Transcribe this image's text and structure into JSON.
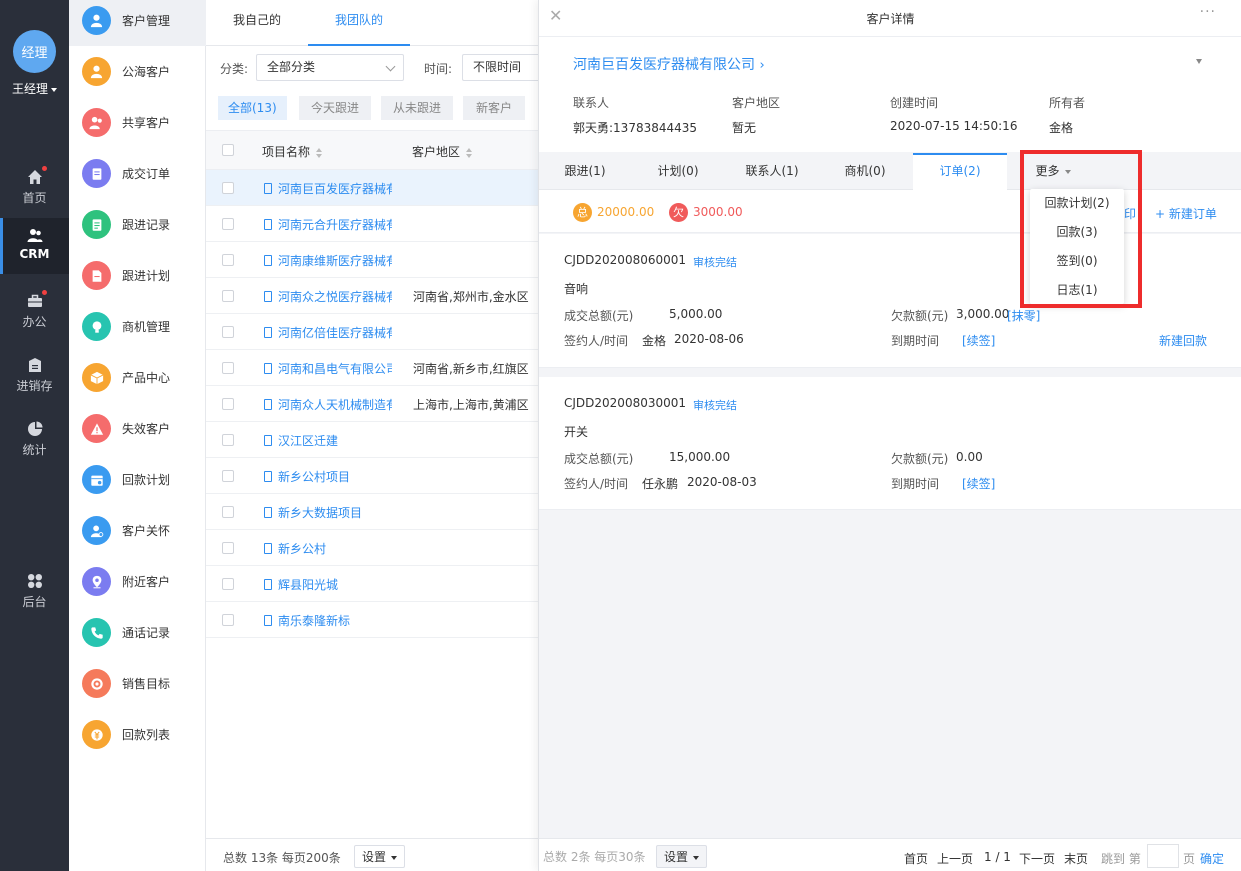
{
  "nav": {
    "avatar_text": "经理",
    "user_name": "王经理",
    "items": [
      {
        "label": "首页",
        "dot": true
      },
      {
        "label": "CRM",
        "dot": false
      },
      {
        "label": "办公",
        "dot": true
      },
      {
        "label": "进销存",
        "dot": false
      },
      {
        "label": "统计",
        "dot": false
      },
      {
        "label": "后台",
        "dot": false
      }
    ]
  },
  "menu": {
    "items": [
      {
        "label": "客户管理",
        "color": "#3a9bf0"
      },
      {
        "label": "公海客户",
        "color": "#f7a531"
      },
      {
        "label": "共享客户",
        "color": "#f56c6c"
      },
      {
        "label": "成交订单",
        "color": "#7b7cf0"
      },
      {
        "label": "跟进记录",
        "color": "#2ec27e"
      },
      {
        "label": "跟进计划",
        "color": "#f56c6c"
      },
      {
        "label": "商机管理",
        "color": "#27c4b0"
      },
      {
        "label": "产品中心",
        "color": "#f7a531"
      },
      {
        "label": "失效客户",
        "color": "#f56c6c"
      },
      {
        "label": "回款计划",
        "color": "#3a9bf0"
      },
      {
        "label": "客户关怀",
        "color": "#3a9bf0"
      },
      {
        "label": "附近客户",
        "color": "#7b7cf0"
      },
      {
        "label": "通话记录",
        "color": "#27c4b0"
      },
      {
        "label": "销售目标",
        "color": "#f57a5b"
      },
      {
        "label": "回款列表",
        "color": "#f7a531"
      }
    ]
  },
  "list": {
    "tabs": [
      "我自己的",
      "我团队的"
    ],
    "filter": {
      "category_label": "分类:",
      "category_value": "全部分类",
      "time_label": "时间:",
      "time_value": "不限时间"
    },
    "chips": [
      "全部(13)",
      "今天跟进",
      "从未跟进",
      "新客户"
    ],
    "columns": [
      "项目名称",
      "客户地区"
    ],
    "rows": [
      {
        "name": "河南巨百发医疗器械有限公司",
        "region": ""
      },
      {
        "name": "河南元合升医疗器械有限公司",
        "region": ""
      },
      {
        "name": "河南康维斯医疗器械有限公司",
        "region": ""
      },
      {
        "name": "河南众之悦医疗器械有限公司",
        "region": "河南省,郑州市,金水区"
      },
      {
        "name": "河南亿倍佳医疗器械有限公司",
        "region": ""
      },
      {
        "name": "河南和昌电气有限公司",
        "region": "河南省,新乡市,红旗区"
      },
      {
        "name": "河南众人天机械制造有限公司",
        "region": "上海市,上海市,黄浦区"
      },
      {
        "name": "汉江区迁建",
        "region": ""
      },
      {
        "name": "新乡公村项目",
        "region": ""
      },
      {
        "name": "新乡大数据项目",
        "region": ""
      },
      {
        "name": "新乡公村",
        "region": ""
      },
      {
        "name": "辉县阳光城",
        "region": ""
      },
      {
        "name": "南乐泰隆新标",
        "region": ""
      }
    ],
    "footer_text": "总数 13条 每页200条",
    "settings_label": "设置"
  },
  "detail": {
    "title": "客户详情",
    "company": "河南巨百发医疗器械有限公司",
    "fields": [
      {
        "label": "联系人",
        "value": "郭天勇:13783844435"
      },
      {
        "label": "客户地区",
        "value": "暂无"
      },
      {
        "label": "创建时间",
        "value": "2020-07-15 14:50:16"
      },
      {
        "label": "所有者",
        "value": "金格"
      }
    ],
    "tabs": [
      "跟进(1)",
      "计划(0)",
      "联系人(1)",
      "商机(0)",
      "订单(2)",
      "更多"
    ],
    "summary": {
      "total_badge": "总",
      "total_value": "20000.00",
      "owe_badge": "欠",
      "owe_value": "3000.00",
      "partial_link": "印",
      "new_order": "+ 新建订单"
    },
    "orders": [
      {
        "code": "CJDD202008060001",
        "status": "审核完结",
        "product": "音响",
        "amount_label": "成交总额(元)",
        "amount": "5,000.00",
        "owe_label": "欠款额(元)",
        "owe": "3,000.00",
        "owe_link": "[抹零]",
        "signer_label": "签约人/时间",
        "signer": "金格",
        "sign_date": "2020-08-06",
        "due_label": "到期时间",
        "due_link": "[续签]",
        "new_payment": "新建回款"
      },
      {
        "code": "CJDD202008030001",
        "status": "审核完结",
        "product": "开关",
        "amount_label": "成交总额(元)",
        "amount": "15,000.00",
        "owe_label": "欠款额(元)",
        "owe": "0.00",
        "owe_link": "",
        "signer_label": "签约人/时间",
        "signer": "任永鹏",
        "sign_date": "2020-08-03",
        "due_label": "到期时间",
        "due_link": "[续签]",
        "new_payment": ""
      }
    ],
    "footer": {
      "summary": "总数 2条 每页30条",
      "settings_label": "设置",
      "first": "首页",
      "prev": "上一页",
      "page": "1 / 1",
      "next": "下一页",
      "last": "末页",
      "jump_prefix": "跳到 第",
      "jump_suffix": "页",
      "confirm": "确定"
    }
  },
  "more_menu": {
    "items": [
      "回款计划(2)",
      "回款(3)",
      "签到(0)",
      "日志(1)"
    ]
  },
  "colors": {
    "accent": "#2d8cf0",
    "nav_bg": "#2a2f3a",
    "highlight_frame": "#ee2c2c",
    "total_badge": "#f7a531",
    "owe_badge": "#f05a5a"
  }
}
